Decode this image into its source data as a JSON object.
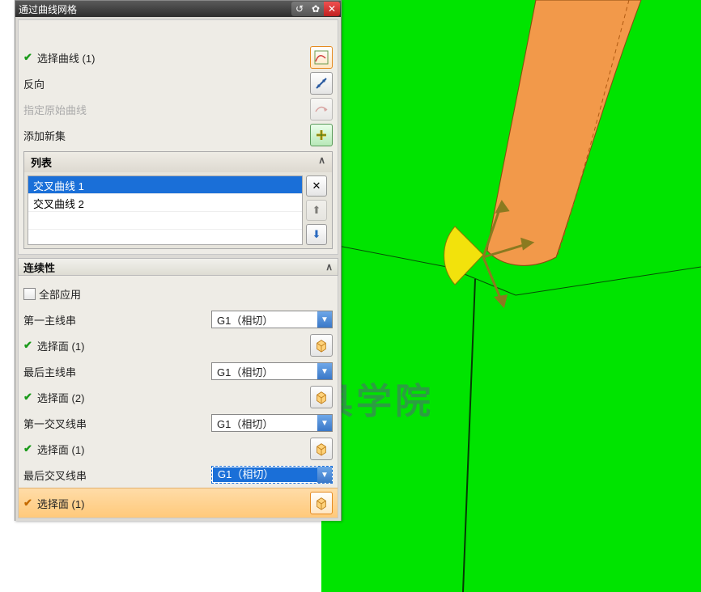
{
  "dialog": {
    "title": "通过曲线网格",
    "section1": {
      "select_curve": "选择曲线 (1)",
      "reverse": "反向",
      "orig_curve": "指定原始曲线",
      "add_set": "添加新集",
      "list": {
        "header": "列表",
        "items": [
          "交叉曲线 1",
          "交叉曲线 2"
        ]
      }
    },
    "continuity": {
      "header": "连续性",
      "apply_all": "全部应用",
      "first_primary": "第一主线串",
      "last_primary": "最后主线串",
      "first_cross": "第一交叉线串",
      "last_cross": "最后交叉线串",
      "select_face1": "选择面 (1)",
      "select_face2": "选择面 (2)",
      "combo_val": "G1（相切）",
      "combo_val_en": "G1 (相切)"
    }
  },
  "watermark": "青华模具学院"
}
